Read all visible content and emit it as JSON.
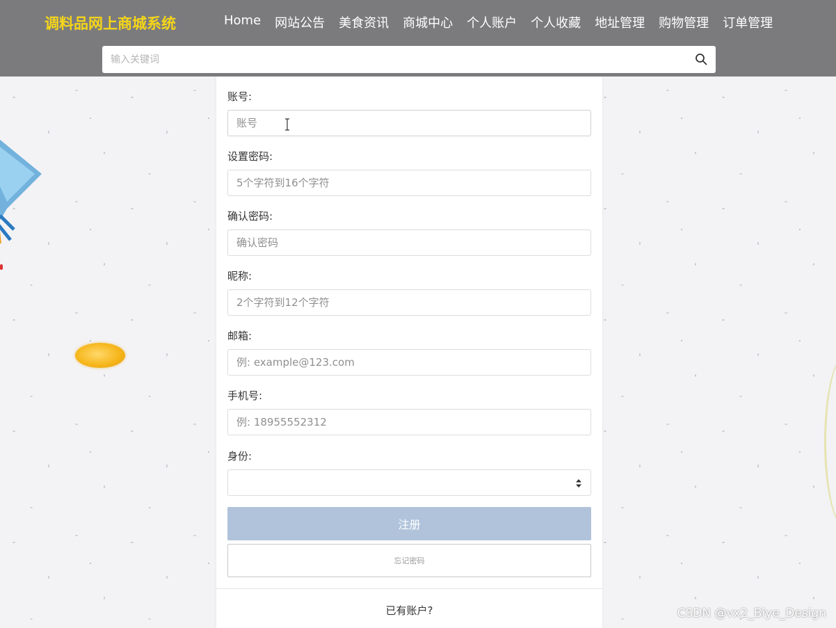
{
  "header": {
    "logo": "调料品网上商城系统",
    "nav": [
      "Home",
      "网站公告",
      "美食资讯",
      "商城中心",
      "个人账户",
      "个人收藏",
      "地址管理",
      "购物管理",
      "订单管理"
    ],
    "search_placeholder": "输入关键词",
    "search_icon": "search-icon"
  },
  "form": {
    "fields": [
      {
        "label": "账号:",
        "placeholder": "账号"
      },
      {
        "label": "设置密码:",
        "placeholder": "5个字符到16个字符"
      },
      {
        "label": "确认密码:",
        "placeholder": "确认密码"
      },
      {
        "label": "昵称:",
        "placeholder": "2个字符到12个字符"
      },
      {
        "label": "邮箱:",
        "placeholder": "例: example@123.com"
      },
      {
        "label": "手机号:",
        "placeholder": "例: 18955552312"
      }
    ],
    "identity_label": "身份:",
    "identity_value": "",
    "register_label": "注册",
    "forgot_label": "忘记密码",
    "have_account": "已有账户?"
  },
  "colors": {
    "header_bg": "#7b7b7e",
    "logo": "#f5d519",
    "register_button": "#b0c3db"
  },
  "watermark": "CSDN @vx2_Biye_Design"
}
